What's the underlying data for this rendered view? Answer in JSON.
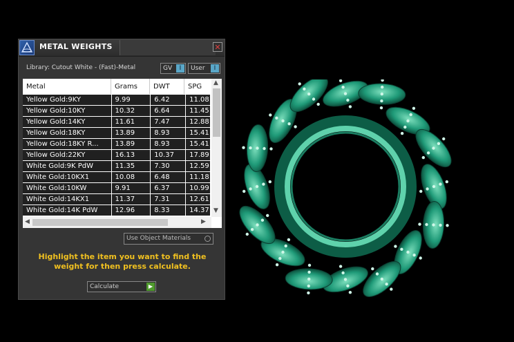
{
  "window": {
    "title": "METAL WEIGHTS"
  },
  "library_label": "Library: Cutout White - (Fast)-Metal",
  "toggles": [
    {
      "label": "GV",
      "knob": "I"
    },
    {
      "label": "User",
      "knob": "I"
    }
  ],
  "table": {
    "columns": [
      "Metal",
      "Grams",
      "DWT",
      "SPG"
    ],
    "rows": [
      [
        "Yellow Gold:9KY",
        "9.99",
        "6.42",
        "11.08"
      ],
      [
        "Yellow Gold:10KY",
        "10.32",
        "6.64",
        "11.45"
      ],
      [
        "Yellow Gold:14KY",
        "11.61",
        "7.47",
        "12.88"
      ],
      [
        "Yellow Gold:18KY",
        "13.89",
        "8.93",
        "15.41"
      ],
      [
        "Yellow Gold:18KY R...",
        "13.89",
        "8.93",
        "15.41"
      ],
      [
        "Yellow Gold:22KY",
        "16.13",
        "10.37",
        "17.89"
      ],
      [
        "White Gold:9K PdW",
        "11.35",
        "7.30",
        "12.59"
      ],
      [
        "White Gold:10KX1",
        "10.08",
        "6.48",
        "11.18"
      ],
      [
        "White Gold:10KW",
        "9.91",
        "6.37",
        "10.99"
      ],
      [
        "White Gold:14KX1",
        "11.37",
        "7.31",
        "12.61"
      ],
      [
        "White Gold:14K PdW",
        "12.96",
        "8.33",
        "14.37"
      ]
    ]
  },
  "use_object_materials": "Use Object Materials",
  "hint": "Highlight the item you want to find the weight for then press calculate.",
  "calculate_label": "Calculate",
  "colors": {
    "hint": "#f0c020",
    "ring": "#1f9a78",
    "ring_light": "#8fe6c8"
  }
}
